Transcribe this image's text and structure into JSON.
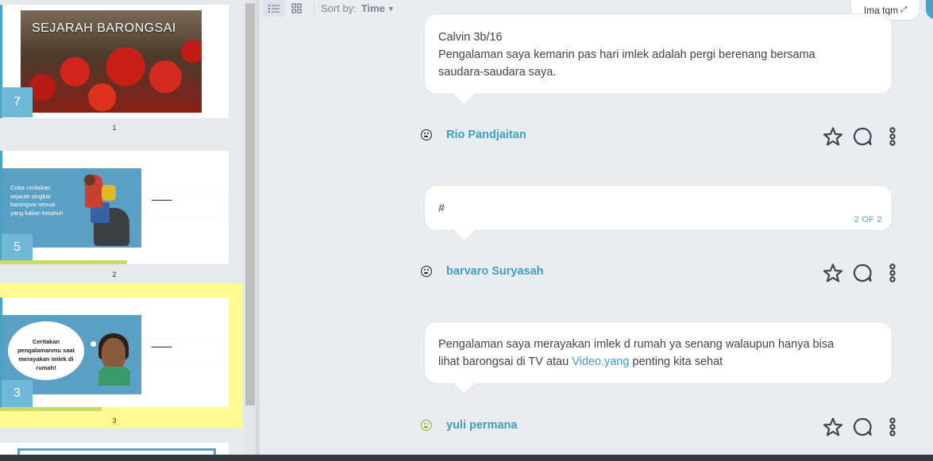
{
  "slides": [
    {
      "badge": "7",
      "number": "1",
      "title": "SEJARAH BARONGSAI"
    },
    {
      "badge": "5",
      "number": "2",
      "text": "Coba ceritakan sejarah singkat barongsai sesuai yang kalian ketahui!",
      "progress": 0.55
    },
    {
      "badge": "3",
      "number": "3",
      "text": "Ceritakan pengalamanmu saat merayakan imlek di rumah!",
      "progress": 0.44,
      "selected": true
    }
  ],
  "toolbar": {
    "list_view_icon": "list-icon",
    "grid_view_icon": "grid-icon",
    "sort_label": "Sort by:",
    "sort_value": "Time"
  },
  "user": {
    "name": "Ima tqm",
    "expand_icon": "expand-icon"
  },
  "comments": [
    {
      "lines": [
        "Calvin 3b/16",
        "Pengalaman saya kemarin pas hari imlek adalah pergi berenang bersama",
        "saudara-saudara saya."
      ]
    },
    {
      "author": "Rio Pandjaitan",
      "author_icon": "neutral-face-icon",
      "text": "#",
      "pager": "2 OF 2"
    },
    {
      "author": "barvaro Suryasah",
      "author_icon": "neutral-face-icon",
      "line1": "Pengalaman saya merayakan imlek d rumah ya senang walaupun  hanya bisa",
      "line2_pre": "lihat barongsai di TV atau ",
      "line2_link": "Video.yang",
      "line2_post": " penting kita sehat"
    },
    {
      "author": "yuli permana",
      "author_icon": "smile-face-icon"
    }
  ],
  "colors": {
    "accent": "#3f9fc3",
    "selected_slide": "#fdfb8f",
    "progress": "#c8da68"
  }
}
